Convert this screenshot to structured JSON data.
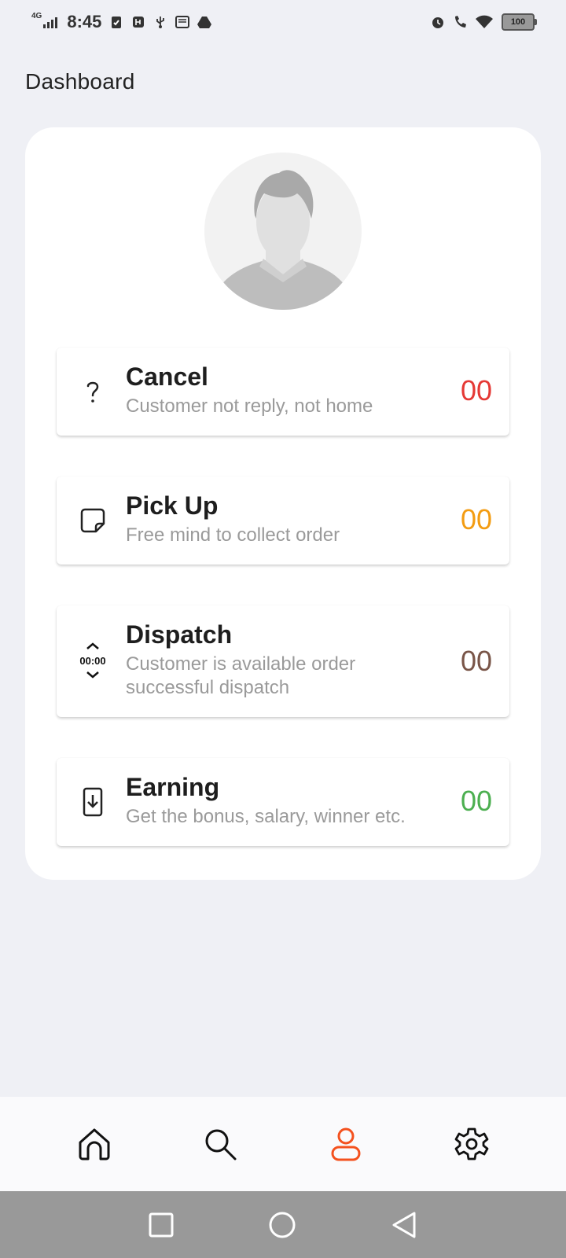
{
  "status_bar": {
    "network": "4G",
    "time": "8:45",
    "battery": "100"
  },
  "header": {
    "title": "Dashboard"
  },
  "profile": {
    "avatar_icon": "person-placeholder-icon"
  },
  "items": [
    {
      "title": "Cancel",
      "subtitle": "Customer not reply, not home",
      "count": "00",
      "count_color": "#e53935",
      "icon": "question-mark-icon"
    },
    {
      "title": "Pick Up",
      "subtitle": "Free mind to collect order",
      "count": "00",
      "count_color": "#f39c12",
      "icon": "sticky-note-icon"
    },
    {
      "title": "Dispatch",
      "subtitle": "Customer is available order successful dispatch",
      "count": "00",
      "count_color": "#795548",
      "icon": "timer-stepper-icon",
      "icon_text": "00:00"
    },
    {
      "title": "Earning",
      "subtitle": "Get the bonus, salary, winner etc.",
      "count": "00",
      "count_color": "#4caf50",
      "icon": "phone-download-icon"
    }
  ],
  "bottom_nav": [
    {
      "name": "home",
      "icon": "home-icon",
      "active": false
    },
    {
      "name": "search",
      "icon": "search-icon",
      "active": false
    },
    {
      "name": "profile",
      "icon": "user-icon",
      "active": true
    },
    {
      "name": "settings",
      "icon": "gear-icon",
      "active": false
    }
  ],
  "colors": {
    "accent": "#f4511e",
    "background": "#eff0f5"
  }
}
